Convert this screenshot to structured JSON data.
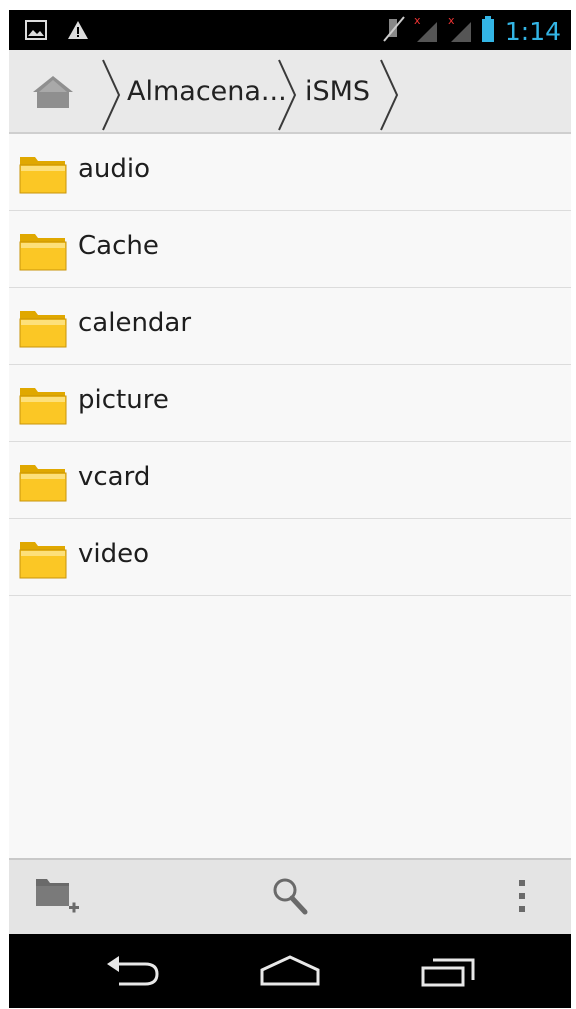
{
  "status_bar": {
    "time": "1:14",
    "icons": [
      "image-notification-icon",
      "warning-icon",
      "mute-icon",
      "signal-no-service-icon",
      "signal-no-service-icon",
      "battery-icon"
    ]
  },
  "breadcrumb": {
    "home_icon": "home-icon",
    "items": [
      "Almacena...",
      "iSMS"
    ]
  },
  "files": [
    {
      "name": "audio",
      "icon": "folder-icon"
    },
    {
      "name": "Cache",
      "icon": "folder-icon"
    },
    {
      "name": "calendar",
      "icon": "folder-icon"
    },
    {
      "name": "picture",
      "icon": "folder-icon"
    },
    {
      "name": "vcard",
      "icon": "folder-icon"
    },
    {
      "name": "video",
      "icon": "folder-icon"
    }
  ],
  "action_bar": {
    "icons": [
      "new-folder-icon",
      "search-icon",
      "overflow-menu-icon"
    ]
  },
  "nav_bar": {
    "icons": [
      "back-icon",
      "home-icon",
      "recents-icon"
    ]
  },
  "colors": {
    "accent": "#33b5e5",
    "folder": "#f5c518"
  }
}
